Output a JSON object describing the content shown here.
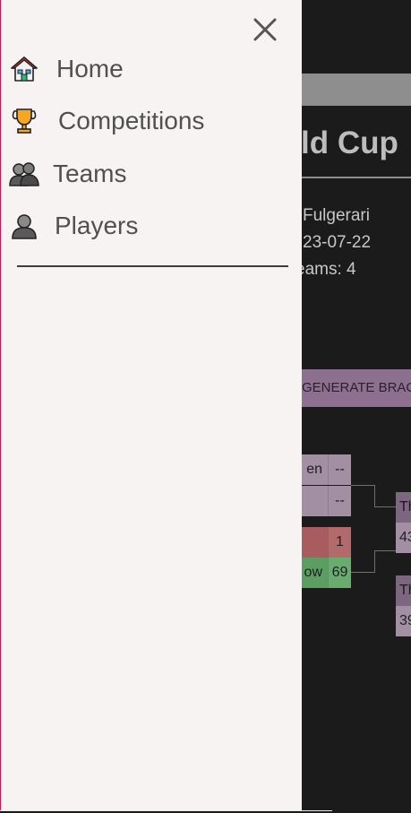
{
  "background": {
    "title": "ld Cup",
    "info": [
      "Fulgerari",
      "23-07-22",
      "eams: 4"
    ],
    "generate_button": "GENERATE BRAC",
    "bracket": {
      "round1": [
        {
          "name": "en",
          "score": "--"
        },
        {
          "name": "",
          "score": "--"
        },
        {
          "name": "",
          "score": "1"
        },
        {
          "name": "ow",
          "score": "69"
        }
      ],
      "round2": [
        {
          "header": "Th",
          "value": "43"
        },
        {
          "header": "Th",
          "value": "39"
        }
      ]
    }
  },
  "sidebar": {
    "close_icon": "close-icon",
    "items": [
      {
        "label": "Home",
        "icon": "house-icon"
      },
      {
        "label": "Competitions",
        "icon": "trophy-icon"
      },
      {
        "label": "Teams",
        "icon": "people-icon"
      },
      {
        "label": "Players",
        "icon": "person-icon"
      }
    ]
  },
  "colors": {
    "drawer_bg": "#f7f3f2",
    "page_bg": "#1b1b1b",
    "accent_purple": "#8d6f8f",
    "win_green": "#5c9e62",
    "lose_red": "#a95c5e"
  }
}
